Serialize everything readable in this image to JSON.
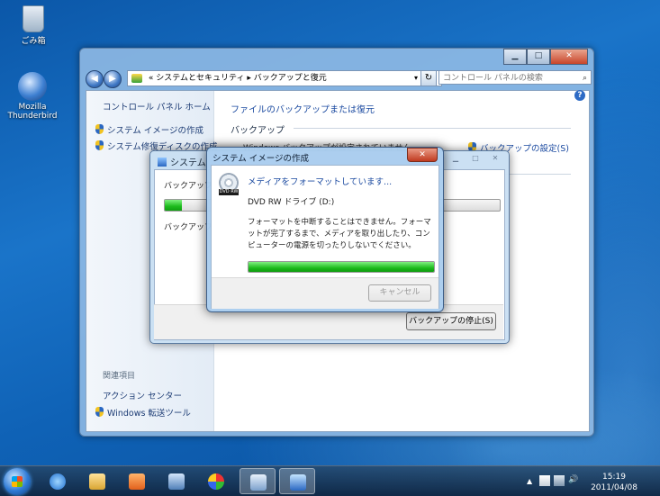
{
  "desktop": {
    "icons": [
      {
        "label": "ごみ箱"
      },
      {
        "label": "Mozilla Thunderbird"
      }
    ]
  },
  "control_panel": {
    "caption": {
      "minimize": "▁",
      "maximize": "□",
      "close": "✕"
    },
    "nav": {
      "back": "◀",
      "forward": "▶"
    },
    "address": {
      "chevron": "«",
      "crumb1": "システムとセキュリティ",
      "sep": "▸",
      "crumb2": "バックアップと復元",
      "dropdown": "▾"
    },
    "refresh": "↻",
    "search_placeholder": "コントロール パネルの検索",
    "search_icon": "⌕",
    "help": "?",
    "sidebar": {
      "home": "コントロール パネル ホーム",
      "items": [
        {
          "label": "システム イメージの作成",
          "icon": "shield-icon"
        },
        {
          "label": "システム修復ディスクの作成",
          "icon": "shield-icon"
        }
      ],
      "related_title": "関連項目",
      "related": [
        {
          "label": "アクション センター"
        },
        {
          "label": "Windows 転送ツール",
          "icon": "shield-icon"
        }
      ]
    },
    "main": {
      "title": "ファイルのバックアップまたは復元",
      "backup_heading": "バックアップ",
      "status": "Windows バックアップが設定されていません。",
      "settings_link": "バックアップの設定(S)"
    }
  },
  "backup_dialog": {
    "title": "システム イメージの作成",
    "title_short": "システム",
    "line1": "バックアップを作成しています...",
    "progress": 0.05,
    "line2": "バックアップの作成中です...",
    "caption": {
      "minimize": "▁",
      "maximize": "□",
      "close": "✕"
    },
    "stop_button": "バックアップの停止(S)"
  },
  "format_dialog": {
    "title": "システム イメージの作成",
    "close": "✕",
    "status": "メディアをフォーマットしています...",
    "drive": "DVD RW ドライブ (D:)",
    "note": "フォーマットを中断することはできません。フォーマットが完了するまで、メディアを取り出したり、コンピューターの電源を切ったりしないでください。",
    "progress": 1.0,
    "cancel_button": "キャンセル",
    "dvd_label": "DVD RW"
  },
  "taskbar": {
    "show_hidden": "▲",
    "clock_time": "15:19",
    "clock_date": "2011/04/08",
    "volume_icon": "🔊",
    "colors": {
      "start": "#2f7bd6"
    }
  }
}
